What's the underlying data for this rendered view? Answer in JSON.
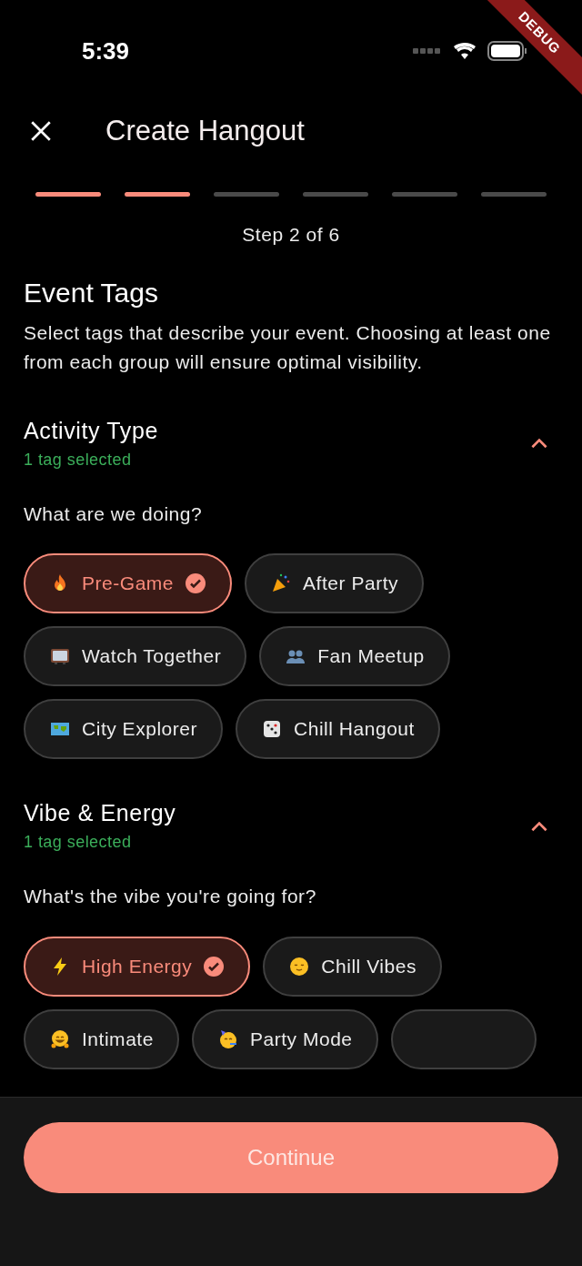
{
  "status_bar": {
    "time": "5:39"
  },
  "debug_banner": "DEBUG",
  "header": {
    "title": "Create Hangout"
  },
  "progress": {
    "steps": [
      {
        "done": true
      },
      {
        "done": true
      },
      {
        "done": false
      },
      {
        "done": false
      },
      {
        "done": false
      },
      {
        "done": false
      }
    ],
    "label": "Step 2 of 6"
  },
  "intro": {
    "title": "Event Tags",
    "description": "Select tags that describe your event. Choosing at least one from each group will ensure optimal visibility."
  },
  "groups": [
    {
      "title": "Activity Type",
      "count": "1 tag selected",
      "expanded": true,
      "question": "What are we doing?",
      "tags": [
        {
          "label": "Pre-Game",
          "kind": "flame",
          "selected": true
        },
        {
          "label": "After Party",
          "kind": "popper",
          "selected": false
        },
        {
          "label": "Watch Together",
          "kind": "tv",
          "selected": false
        },
        {
          "label": "Fan Meetup",
          "kind": "people",
          "selected": false
        },
        {
          "label": "City Explorer",
          "kind": "map",
          "selected": false
        },
        {
          "label": "Chill Hangout",
          "kind": "dice",
          "selected": false
        }
      ]
    },
    {
      "title": "Vibe & Energy",
      "count": "1 tag selected",
      "expanded": true,
      "question": "What's the vibe you're going for?",
      "tags": [
        {
          "label": "High Energy",
          "kind": "bolt",
          "selected": true
        },
        {
          "label": "Chill Vibes",
          "kind": "relieved",
          "selected": false
        },
        {
          "label": "Intimate",
          "kind": "hug",
          "selected": false
        },
        {
          "label": "Party Mode",
          "kind": "partyface",
          "selected": false
        },
        {
          "kind": "clipped",
          "selected": false
        }
      ]
    }
  ],
  "footer": {
    "button": "Continue"
  }
}
